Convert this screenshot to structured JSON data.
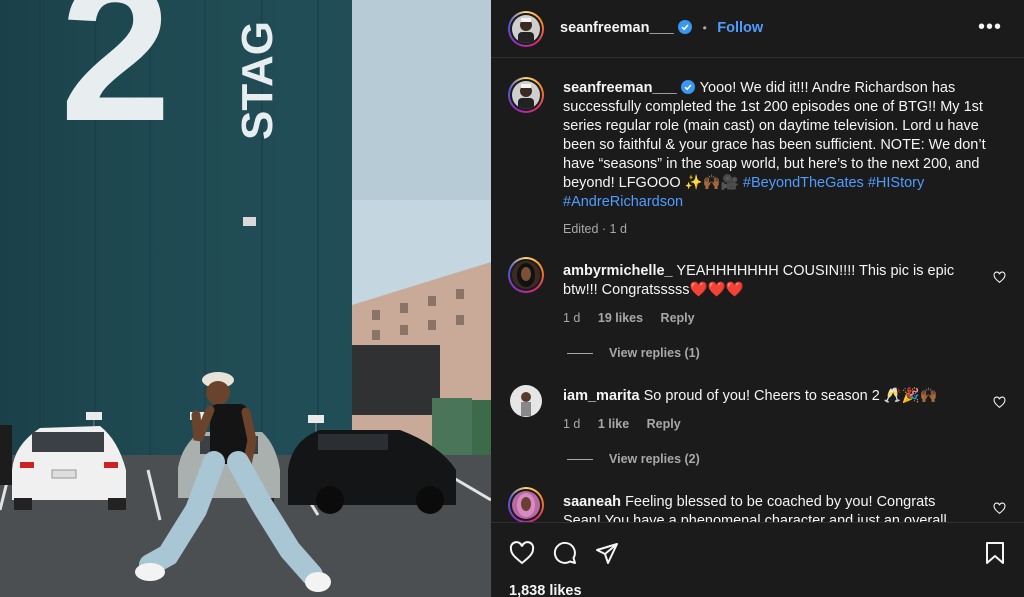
{
  "post": {
    "author": "seanfreeman___",
    "follow_label": "Follow",
    "dot_separator": "•",
    "more_icon": "more-dots-icon",
    "photo_sign": {
      "big_number": "2",
      "stage_text": "STAG"
    },
    "caption_text": "Yooo! We did it!!! Andre Richardson has successfully completed the 1st 200 episodes one of BTG!! My 1st series regular role (main cast) on daytime television. Lord u have been so faithful & your grace has been sufficient. NOTE: We don’t have “seasons” in the soap world, but here’s to the next 200, and beyond! LFGOOO ✨🙌🏾🎥",
    "hashtags": [
      "#BeyondTheGates",
      "#HIStory",
      "#AndreRichardson"
    ],
    "caption_meta": "Edited · 1 d",
    "likes": "1,838 likes"
  },
  "comments": [
    {
      "user": "ambyrmichelle_",
      "text": "YEAHHHHHHH COUSIN!!!! This pic is epic btw!!! Congratsssss❤️❤️❤️",
      "time": "1 d",
      "likes": "19 likes",
      "reply_label": "Reply",
      "view_replies": "View replies (1)"
    },
    {
      "user": "iam_marita",
      "text": "So proud of you! Cheers to season 2 🥂🎉🙌🏾",
      "time": "1 d",
      "likes": "1 like",
      "reply_label": "Reply",
      "view_replies": "View replies (2)"
    },
    {
      "user": "saaneah",
      "text": "Feeling blessed to be coached by you! Congrats Sean! You have a phenomenal character and just an overall"
    }
  ],
  "colors": {
    "pane_bg": "#1b1b1b",
    "link_blue": "#4f9cff",
    "muted": "#a8a8a8",
    "building_teal": "#1e4a52"
  }
}
